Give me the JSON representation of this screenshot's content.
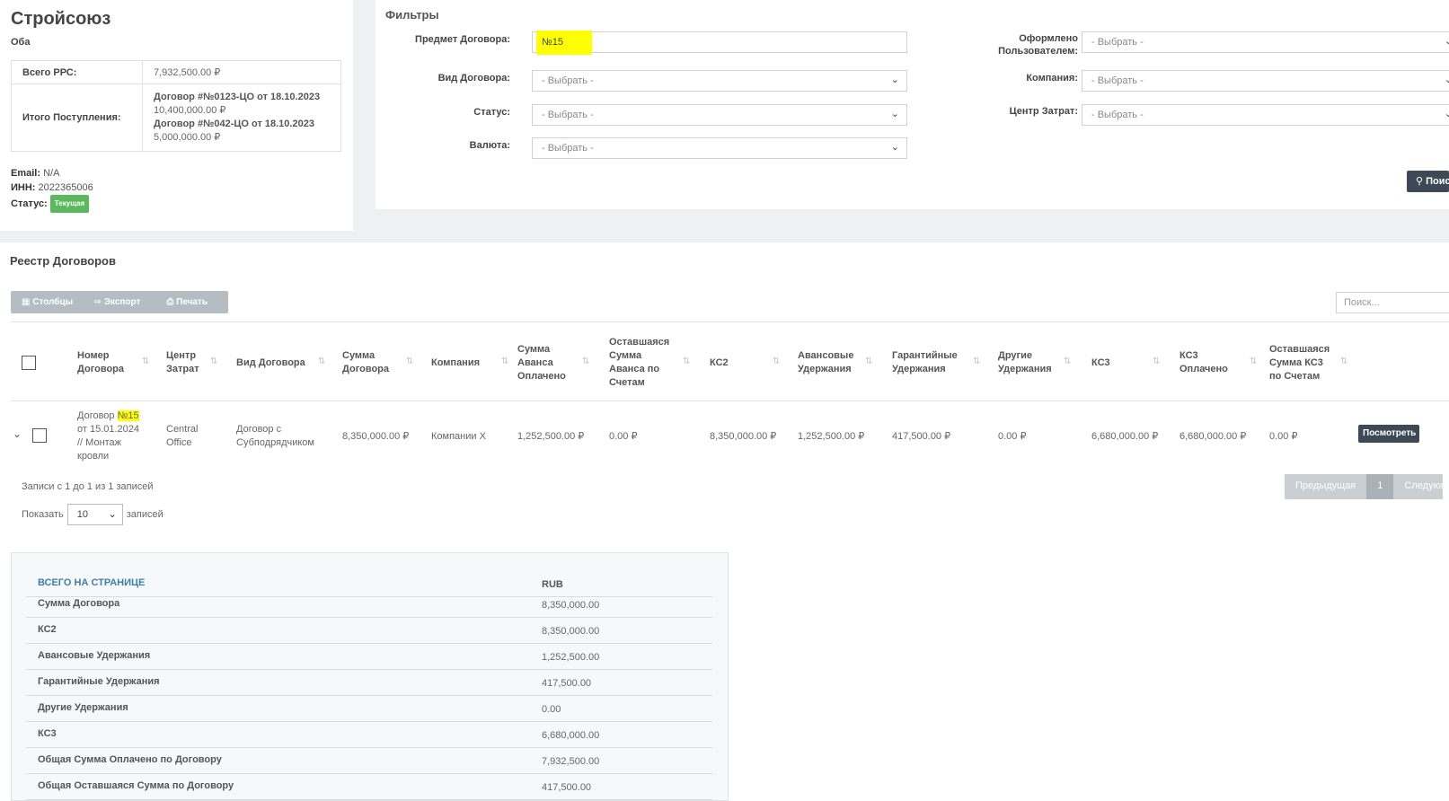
{
  "company": {
    "name": "Стройсоюз",
    "subtitle": "Оба",
    "info": [
      {
        "label": "Всего РРС:",
        "value": "7,932,500.00 ₽"
      }
    ],
    "income_label": "Итого Поступления:",
    "income": [
      {
        "contract": "Договор #№0123-ЦО от 18.10.2023",
        "amount": "10,400,000.00 ₽"
      },
      {
        "contract": "Договор #№042-ЦО от 18.10.2023",
        "amount": "5,000,000.00 ₽"
      }
    ],
    "email_label": "Email:",
    "email": "N/A",
    "inn_label": "ИНН:",
    "inn": "2022365006",
    "status_label": "Статус:",
    "status": "Текущая"
  },
  "filters": {
    "title": "Фильтры",
    "subject_label": "Предмет Договора:",
    "subject_value": "№15",
    "type_label": "Вид Договора:",
    "type_value": "- Выбрать -",
    "status_label": "Статус:",
    "status_value": "- Выбрать -",
    "currency_label": "Валюта:",
    "currency_value": "- Выбрать -",
    "user_label_1": "Оформлено",
    "user_label_2": "Пользователем:",
    "user_value": "- Выбрать -",
    "company_label": "Компания:",
    "company_value": "- Выбрать -",
    "cost_center_label": "Центр Затрат:",
    "cost_center_value": "- Выбрать -",
    "search_button": "Поиск"
  },
  "registry": {
    "title": "Реестр Договоров",
    "toolbar": {
      "columns": "Столбцы",
      "export": "Экспорт",
      "print": "Печать"
    },
    "search_placeholder": "Поиск...",
    "headers": [
      [
        "Номер",
        "Договора"
      ],
      [
        "Центр",
        "Затрат"
      ],
      [
        "Вид Договора"
      ],
      [
        "Сумма",
        "Договора"
      ],
      [
        "Компания"
      ],
      [
        "Сумма",
        "Аванса",
        "Оплачено"
      ],
      [
        "Оставшаяся",
        "Сумма",
        "Аванса по",
        "Счетам"
      ],
      [
        "КС2"
      ],
      [
        "Авансовые",
        "Удержания"
      ],
      [
        "Гарантийные",
        "Удержания"
      ],
      [
        "Другие",
        "Удержания"
      ],
      [
        "КС3"
      ],
      [
        "КС3",
        "Оплачено"
      ],
      [
        "Оставшаяся",
        "Сумма КС3",
        "по Счетам"
      ]
    ],
    "row": {
      "number_prefix": "Договор ",
      "number_highlight": "№15",
      "number_rest": [
        "от 15.01.2024",
        "// Монтаж",
        "кровли"
      ],
      "cost_center": [
        "Central",
        "Office"
      ],
      "type": [
        "Договор с",
        "Субподрядчиком"
      ],
      "amount": "8,350,000.00 ₽",
      "company": "Компании Х",
      "advance_paid": "1,252,500.00 ₽",
      "advance_remaining": "0.00 ₽",
      "ks2": "8,350,000.00 ₽",
      "advance_withholding": "1,252,500.00 ₽",
      "guarantee_withholding": "417,500.00 ₽",
      "other_withholding": "0.00 ₽",
      "ks3": "6,680,000.00 ₽",
      "ks3_paid": "6,680,000.00 ₽",
      "ks3_remaining": "0.00 ₽",
      "view_button": "Посмотреть"
    },
    "records_info": "Записи с 1 до 1 из 1 записей",
    "show_label": "Показать",
    "page_size": "10",
    "records_label": "записей",
    "pagination": {
      "prev": "Предыдущая",
      "current": "1",
      "next": "Следующая"
    }
  },
  "totals": {
    "header_label": "ВСЕГО НА СТРАНИЦЕ",
    "currency": "RUB",
    "rows": [
      {
        "label": "Сумма Договора",
        "value": "8,350,000.00"
      },
      {
        "label": "КС2",
        "value": "8,350,000.00"
      },
      {
        "label": "Авансовые Удержания",
        "value": "1,252,500.00"
      },
      {
        "label": "Гарантийные Удержания",
        "value": "417,500.00"
      },
      {
        "label": "Другие Удержания",
        "value": "0.00"
      },
      {
        "label": "КС3",
        "value": "6,680,000.00"
      },
      {
        "label": "Общая Сумма Оплачено по Договору",
        "value": "7,932,500.00"
      },
      {
        "label": "Общая Оставшаяся Сумма по Договору",
        "value": "417,500.00"
      }
    ]
  }
}
